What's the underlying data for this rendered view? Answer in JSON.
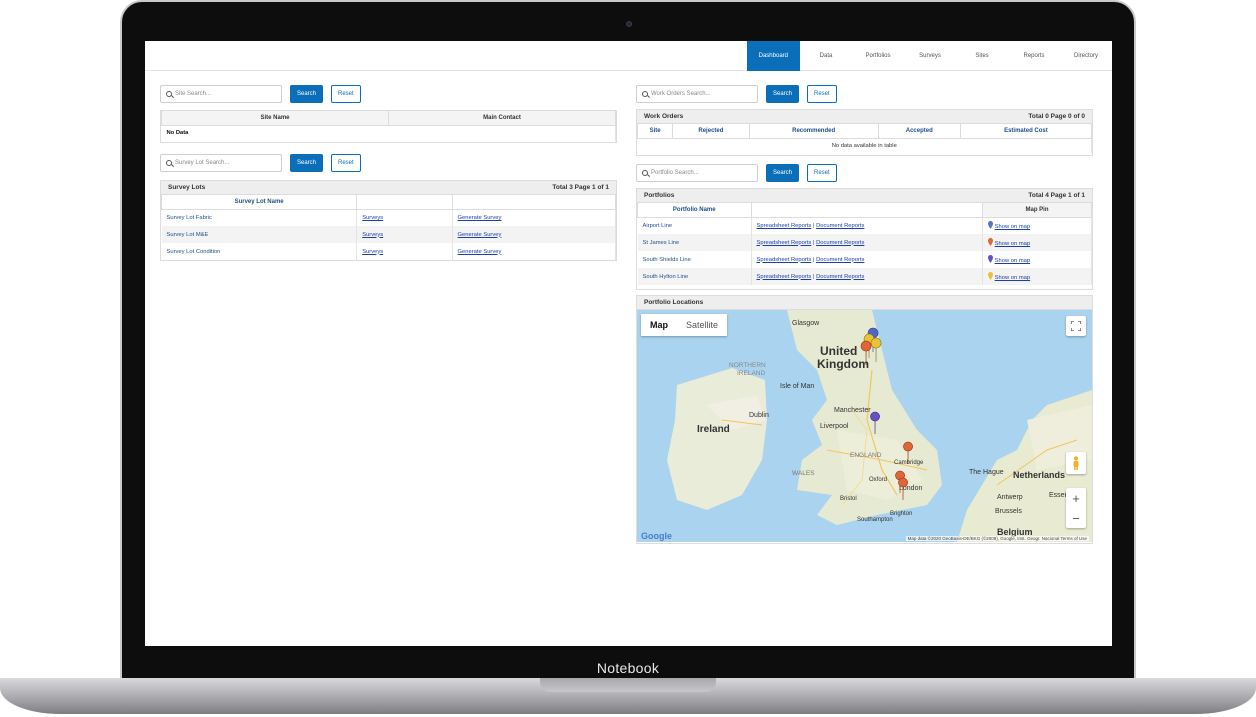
{
  "device": {
    "label": "Notebook"
  },
  "nav": {
    "items": [
      "Dashboard",
      "Data",
      "Portfolios",
      "Surveys",
      "Sites",
      "Reports",
      "Directory"
    ],
    "active": "Dashboard"
  },
  "site_search": {
    "placeholder": "Site Search...",
    "search_label": "Search",
    "reset_label": "Reset"
  },
  "sites_table": {
    "columns": [
      "Site Name",
      "Main Contact"
    ],
    "empty_text": "No Data"
  },
  "survey_lot_search": {
    "placeholder": "Survey Lot Search...",
    "search_label": "Search",
    "reset_label": "Reset"
  },
  "survey_lots": {
    "title": "Survey Lots",
    "summary": "Total 3 Page 1 of 1",
    "columns": [
      "Survey Lot Name",
      "",
      ""
    ],
    "rows": [
      {
        "name": "Survey Lot Fabric",
        "surveys": "Surveys",
        "generate": "Generate Survey"
      },
      {
        "name": "Survey Lot M&E",
        "surveys": "Surveys",
        "generate": "Generate Survey"
      },
      {
        "name": "Survey Lot Condition",
        "surveys": "Surveys",
        "generate": "Generate Survey"
      }
    ]
  },
  "work_orders_search": {
    "placeholder": "Work Orders Search...",
    "search_label": "Search",
    "reset_label": "Reset"
  },
  "work_orders": {
    "title": "Work Orders",
    "summary": "Total 0 Page 0 of 0",
    "columns": [
      "Site",
      "Rejected",
      "Recommended",
      "Accepted",
      "Estimated Cost"
    ],
    "empty_text": "No data available in table"
  },
  "portfolio_search": {
    "placeholder": "Portfolio Search...",
    "search_label": "Search",
    "reset_label": "Reset"
  },
  "portfolios": {
    "title": "Portfolios",
    "summary": "Total 4 Page 1 of 1",
    "columns": [
      "Portfolio Name",
      "",
      "Map Pin"
    ],
    "separator": "|",
    "rows": [
      {
        "name": "Airport Line",
        "spreadsheet": "Spreadsheet Reports",
        "document": "Document Reports",
        "map_link": "Show on map",
        "pin_color": "#5b73c4"
      },
      {
        "name": "St James Line",
        "spreadsheet": "Spreadsheet Reports",
        "document": "Document Reports",
        "map_link": "Show on map",
        "pin_color": "#e0663a"
      },
      {
        "name": "South Shields Line",
        "spreadsheet": "Spreadsheet Reports",
        "document": "Document Reports",
        "map_link": "Show on map",
        "pin_color": "#6a4fc4"
      },
      {
        "name": "South Hylton Line",
        "spreadsheet": "Spreadsheet Reports",
        "document": "Document Reports",
        "map_link": "Show on map",
        "pin_color": "#e8c33a"
      }
    ]
  },
  "portfolio_locations": {
    "title": "Portfolio Locations",
    "map_type": [
      "Map",
      "Satellite"
    ],
    "active_map_type": "Map",
    "labels": [
      "Glasgow",
      "United",
      "Kingdom",
      "NORTHERN",
      "IRELAND",
      "Isle of Man",
      "Dublin",
      "Ireland",
      "Manchester",
      "Liverpool",
      "ENGLAND",
      "Cambridge",
      "WALES",
      "Oxford",
      "London",
      "Bristol",
      "Southampton",
      "Brighton",
      "The Hague",
      "Netherlands",
      "Antwerp",
      "Essen",
      "Brussels",
      "Belgium"
    ],
    "zoom_in": "+",
    "zoom_out": "−",
    "attribution": "Map data ©2020 GeoBasis-DE/BKG (©2009), Google, Inst. Geogr. Nacional   Terms of Use",
    "logo": "Google"
  },
  "colors": {
    "primary": "#0a6fb8",
    "link": "#1b3ea8",
    "header_text": "#1f4e8a"
  }
}
